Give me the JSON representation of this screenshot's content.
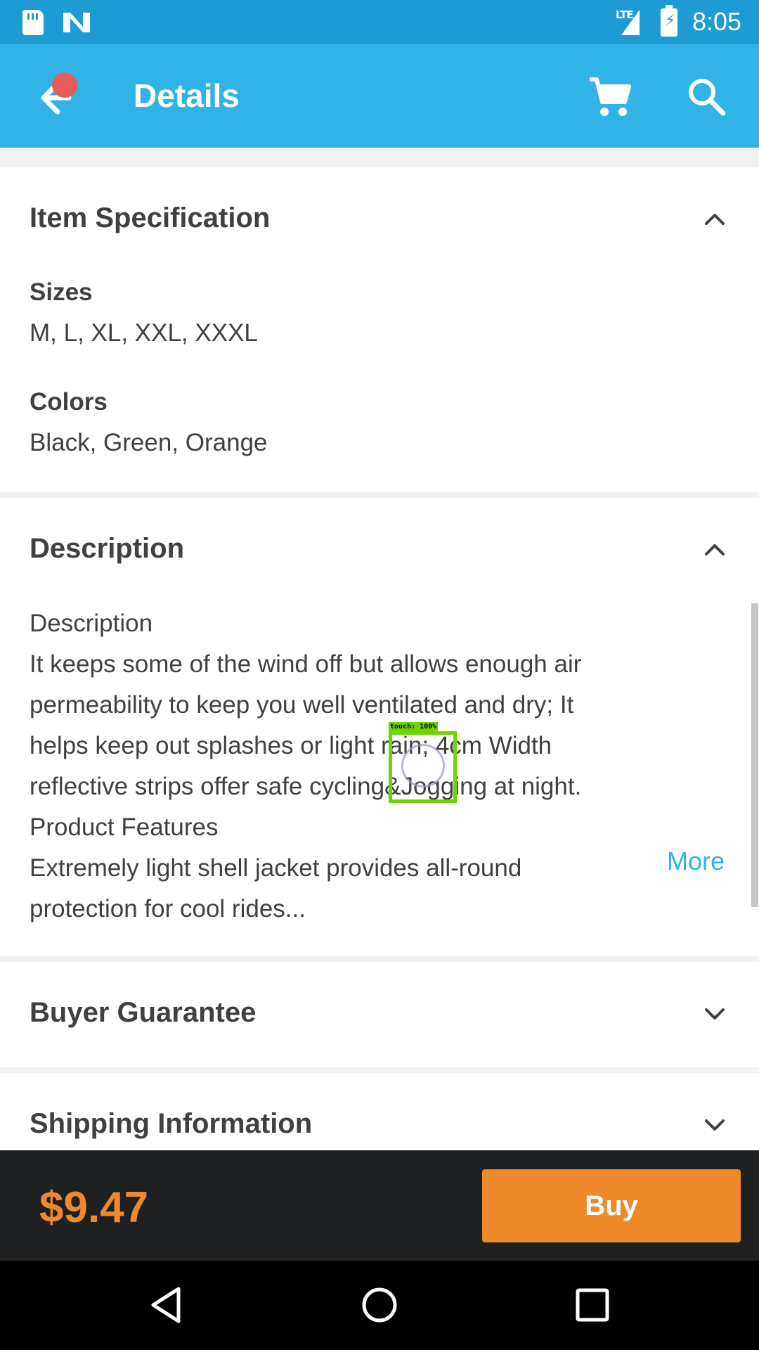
{
  "status_bar": {
    "network_label": "LTE",
    "time": "8:05"
  },
  "app_bar": {
    "title": "Details",
    "icons": [
      "back-arrow-icon",
      "cart-icon",
      "search-icon"
    ],
    "notification_dot_color": "#ea5b5b"
  },
  "item_specification": {
    "title": "Item Specification",
    "expanded": true,
    "sizes_label": "Sizes",
    "sizes_value": "M, L, XL, XXL, XXXL",
    "colors_label": "Colors",
    "colors_value": "Black, Green, Orange"
  },
  "description": {
    "title": "Description",
    "expanded": true,
    "lines": [
      "Description",
      "It keeps some of the wind off but allows enough air",
      "permeability to keep you well ventilated and dry; It",
      "helps keep out splashes or light rain; 4cm Width",
      "reflective strips offer safe cycling&Jogging at night.",
      "Product Features",
      "Extremely light shell jacket provides all-round",
      "protection for cool rides..."
    ],
    "more_label": "More"
  },
  "buyer_guarantee": {
    "title": "Buyer Guarantee",
    "expanded": false
  },
  "shipping_information": {
    "title": "Shipping Information",
    "expanded": false
  },
  "touch_overlay": {
    "label": "touch: 100%"
  },
  "purchase_bar": {
    "price": "$9.47",
    "buy_label": "Buy"
  },
  "colors": {
    "status_bar": "#1f9bd3",
    "app_bar": "#32b3e6",
    "accent_orange": "#ee8a2a",
    "link_blue": "#32b3e6",
    "bottom_bar": "#1e2022"
  }
}
